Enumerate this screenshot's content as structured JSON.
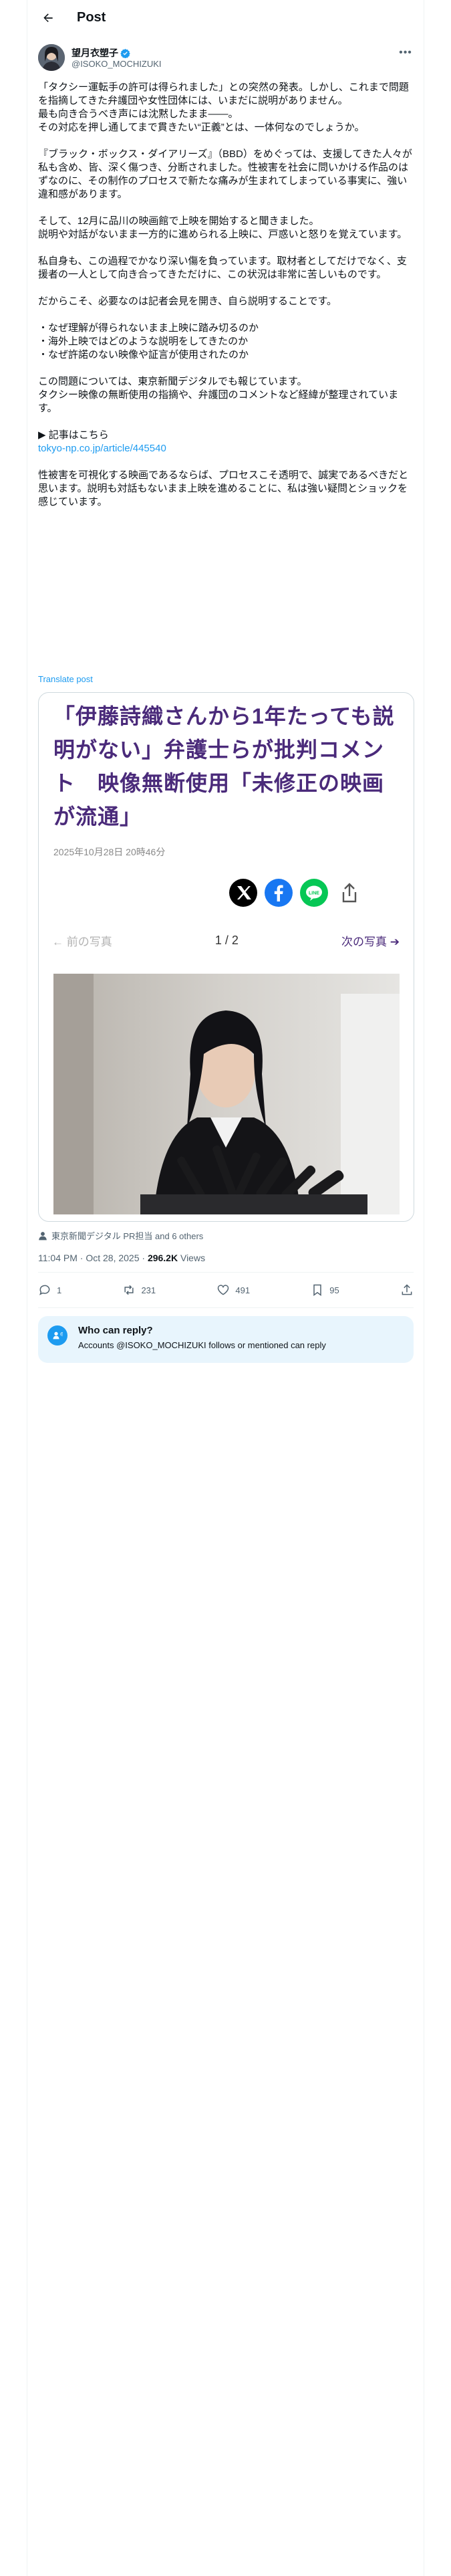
{
  "header": {
    "title": "Post"
  },
  "author": {
    "name": "望月衣塑子",
    "handle": "@ISOKO_MOCHIZUKI",
    "verified": true
  },
  "tweet": {
    "paragraphs": [
      "「タクシー運転手の許可は得られました」との突然の発表。しかし、これまで問題を指摘してきた弁護団や女性団体には、いまだに説明がありません。\n最も向き合うべき声には沈黙したまま――。\nその対応を押し通してまで貫きたい“正義”とは、一体何なのでしょうか。",
      "『ブラック・ボックス・ダイアリーズ』（BBD）をめぐっては、支援してきた人々が私も含め、皆、深く傷つき、分断されました。性被害を社会に問いかける作品のはずなのに、その制作のプロセスで新たな痛みが生まれてしまっている事実に、強い違和感があります。",
      "そして、12月に品川の映画館で上映を開始すると聞きました。\n説明や対話がないまま一方的に進められる上映に、戸惑いと怒りを覚えています。",
      "私自身も、この過程でかなり深い傷を負っています。取材者としてだけでなく、支援者の一人として向き合ってきただけに、この状況は非常に苦しいものです。",
      "だからこそ、必要なのは記者会見を開き、自ら説明することです。",
      "・なぜ理解が得られないまま上映に踏み切るのか\n・海外上映ではどのような説明をしてきたのか\n・なぜ許諾のない映像や証言が使用されたのか",
      "この問題については、東京新聞デジタルでも報じています。\nタクシー映像の無断使用の指摘や、弁護団のコメントなど経緯が整理されています。",
      "▶ 記事はこちら"
    ],
    "link": "tokyo-np.co.jp/article/445540",
    "closing": "性被害を可視化する映画であるならば、プロセスこそ透明で、誠実であるべきだと思います。説明も対話もないまま上映を進めることに、私は強い疑問とショックを感じています。",
    "translate_label": "Translate post"
  },
  "card": {
    "headline": "「伊藤詩織さんから1年たっても説明がない」弁護士らが批判コメント　映像無断使用「未修正の映画が流通」",
    "date": "2025年10月28日 20時46分",
    "share_icons": [
      "x-logo-icon",
      "facebook-icon",
      "line-icon",
      "share-icon"
    ],
    "pager": {
      "prev": "前の写真",
      "count": "1 / 2",
      "next": "次の写真"
    },
    "colors": {
      "headline": "#4a2a7a",
      "line": "#06c755",
      "facebook": "#1877f2"
    }
  },
  "tagged": {
    "label": "東京新聞デジタル PR担当 and 6 others"
  },
  "meta": {
    "time": "11:04 PM · Oct 28, 2025 · ",
    "views": "296.2K",
    "views_label": " Views"
  },
  "actions": {
    "replies": "1",
    "reposts": "231",
    "likes": "491",
    "bookmarks": "95"
  },
  "reply_notice": {
    "title": "Who can reply?",
    "text": "Accounts @ISOKO_MOCHIZUKI follows or mentioned can reply"
  },
  "colors": {
    "accent": "#1d9bf0",
    "text": "#0f1419",
    "muted": "#536471"
  }
}
